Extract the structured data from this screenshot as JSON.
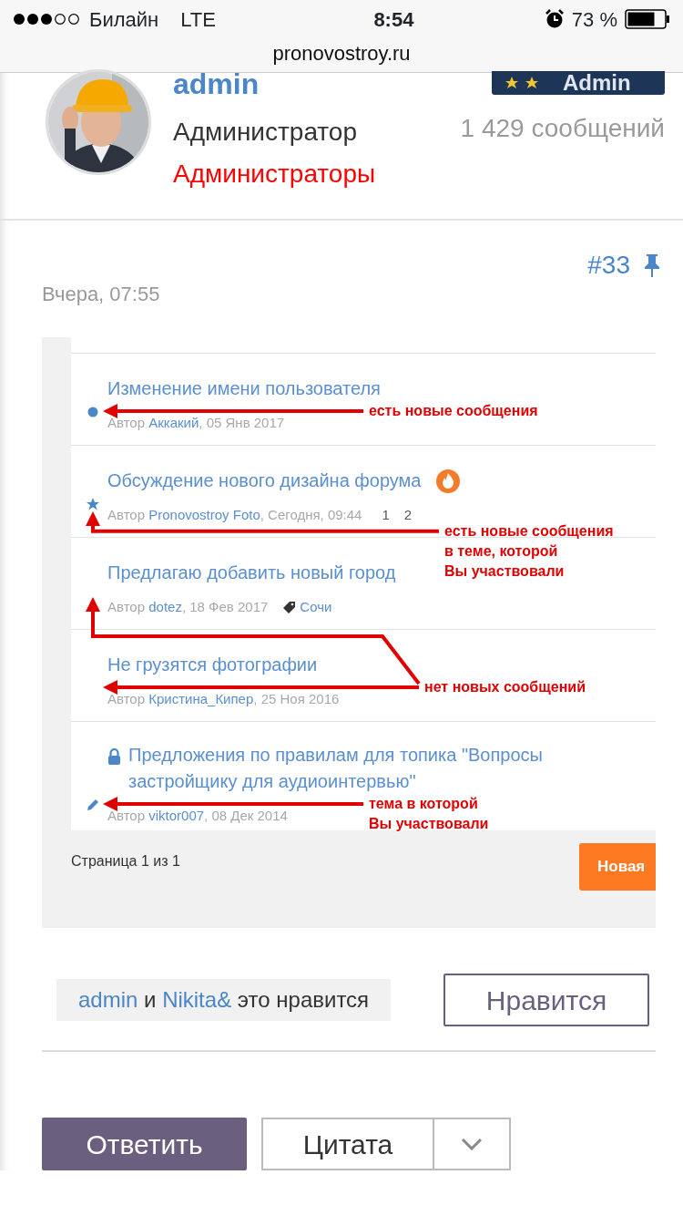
{
  "status_bar": {
    "carrier": "Билайн",
    "network": "LTE",
    "time": "8:54",
    "battery": "73 %"
  },
  "browser": {
    "url": "pronovostroy.ru"
  },
  "profile": {
    "name": "admin",
    "title": "Администратор",
    "group": "Администраторы",
    "badge": "Admin",
    "posts": "1 429 сообщений"
  },
  "post": {
    "number": "#33",
    "date": "Вчера, 07:55"
  },
  "screenshot": {
    "topics": [
      {
        "kind": "dot",
        "locked": false,
        "title": "Изменение имени пользователя",
        "by": "Автор",
        "author": "Аккакий",
        "after": ", 05 Янв 2017",
        "hot": false
      },
      {
        "kind": "star",
        "locked": false,
        "title": "Обсуждение нового дизайна форума",
        "by": "Автор",
        "author": "Pronovostroy Foto",
        "after": ", Сегодня, 09:44",
        "hot": true,
        "pages": [
          "1",
          "2"
        ]
      },
      {
        "kind": "none",
        "locked": false,
        "title": "Предлагаю добавить новый город",
        "by": "Автор",
        "author": "dotez",
        "after": ", 18 Фев 2017",
        "hot": false,
        "tag": "Сочи"
      },
      {
        "kind": "none",
        "locked": false,
        "title": "Не грузятся фотографии",
        "by": "Автор",
        "author": "Кристина_Кипер",
        "after": ", 25 Ноя 2016",
        "hot": false
      },
      {
        "kind": "pencil",
        "locked": true,
        "title": "Предложения по правилам для топика \"Вопросы застройщику для аудиоинтервью\"",
        "by": "Автор",
        "author": "viktor007",
        "after": ", 08 Дек 2014",
        "hot": false
      }
    ],
    "pagination": "Страница 1 из 1",
    "new_topic_button": "Новая",
    "annotations": [
      {
        "lines": [
          "есть новые сообщения"
        ]
      },
      {
        "lines": [
          "есть новые сообщения",
          "в теме, которой",
          "Вы участвовали"
        ]
      },
      {
        "lines": [
          "нет новых сообщений"
        ]
      },
      {
        "lines": [
          "тема в которой",
          "Вы участвовали"
        ]
      }
    ]
  },
  "likes": {
    "parts": [
      {
        "text": "admin",
        "link": true
      },
      {
        "text": "и",
        "link": false
      },
      {
        "text": "Nikita&",
        "link": true
      },
      {
        "text": "это нравится",
        "link": false
      }
    ],
    "button": "Нравится"
  },
  "actions": {
    "reply": "Ответить",
    "quote": "Цитата"
  }
}
